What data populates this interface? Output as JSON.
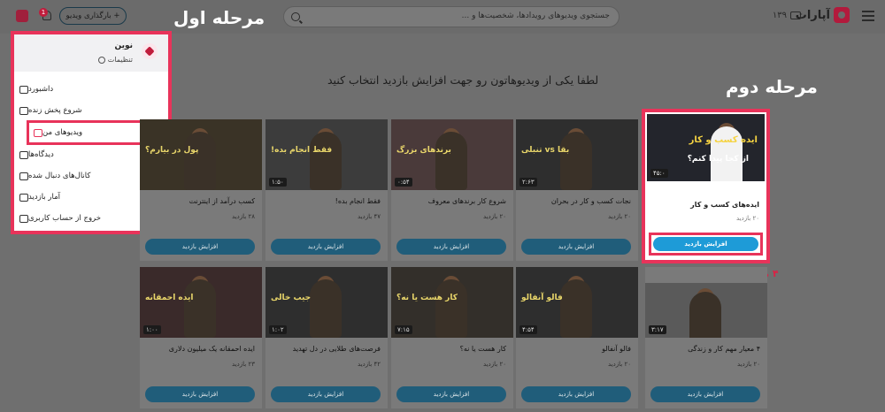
{
  "header": {
    "logo_text": "آپارات",
    "tv_count": "۱۳۹",
    "search_placeholder": "جستجوی ویدیوهای رویدادها، شخصیت‌ها و ...",
    "upload_label": "+ بارگذاری ویدیو",
    "notif_count": "1"
  },
  "annotations": {
    "step1": "مرحله اول",
    "step2": "مرحله دوم"
  },
  "page_title": "لطفا یکی از ویدیوهاتون رو جهت افزایش بازدید انتخاب کنید",
  "menu": {
    "name": "نوین",
    "settings": "تنظیمات",
    "items": [
      {
        "label": "داشبورد"
      },
      {
        "label": "شروع پخش زنده"
      },
      {
        "label": "ویدیوهای من"
      },
      {
        "label": "دیدگاه‌ها"
      },
      {
        "label": "کانال‌های دنبال شده"
      },
      {
        "label": "آمار بازدید"
      },
      {
        "label": "خروج از حساب کاربری"
      }
    ]
  },
  "highlight_card": {
    "overlay1": "ایده کسب و کار",
    "overlay2": "از کجا پیدا کنم؟",
    "duration": "۴۵:۰",
    "title": "ایده‌های کسب و کار",
    "views": "۲۰ بازدید",
    "boost": "افزایش بازدید"
  },
  "cards_row1": [
    {
      "title": "نجات کسب و کار در بحران",
      "views": "۲۰ بازدید",
      "duration": "۲:۶۳",
      "overlay": "بقا vs تنبلی"
    },
    {
      "title": "شروع کار برندهای معروف",
      "views": "۲۰ بازدید",
      "duration": "۰:۵۴",
      "overlay": "برندهای بزرگ"
    },
    {
      "title": "فقط انجام بده!",
      "views": "۴۷ بازدید",
      "duration": "۱:۵۰",
      "overlay": "فقط انجام بده!"
    },
    {
      "title": "کسب درآمد از اینترنت",
      "views": "۲۸ بازدید",
      "duration": "",
      "overlay": "پول در بیارم؟"
    }
  ],
  "cards_row2": [
    {
      "title": "۴ معیار مهم کار و زندگی",
      "views": "۲۰ بازدید",
      "duration": "۳:۱۷",
      "overlay": "۴ معیار مهم کار و زندگی"
    },
    {
      "title": "فالو آنفالو",
      "views": "۲۰ بازدید",
      "duration": "۴:۵۴",
      "overlay": "فالو آنفالو"
    },
    {
      "title": "کار هست یا نه؟",
      "views": "۲۰ بازدید",
      "duration": "۷:۱۵",
      "overlay": "کار هست یا نه؟"
    },
    {
      "title": "فرصت‌های طلایی در دل تهدید",
      "views": "۴۲ بازدید",
      "duration": "۱:۰۲",
      "overlay": "جیب خالی"
    },
    {
      "title": "ایده احمقانه یک میلیون دلاری",
      "views": "۲۳ بازدید",
      "duration": "۱:۰۰",
      "overlay": "ایده احمقانه"
    }
  ],
  "boost_label": "افزایش بازدید"
}
